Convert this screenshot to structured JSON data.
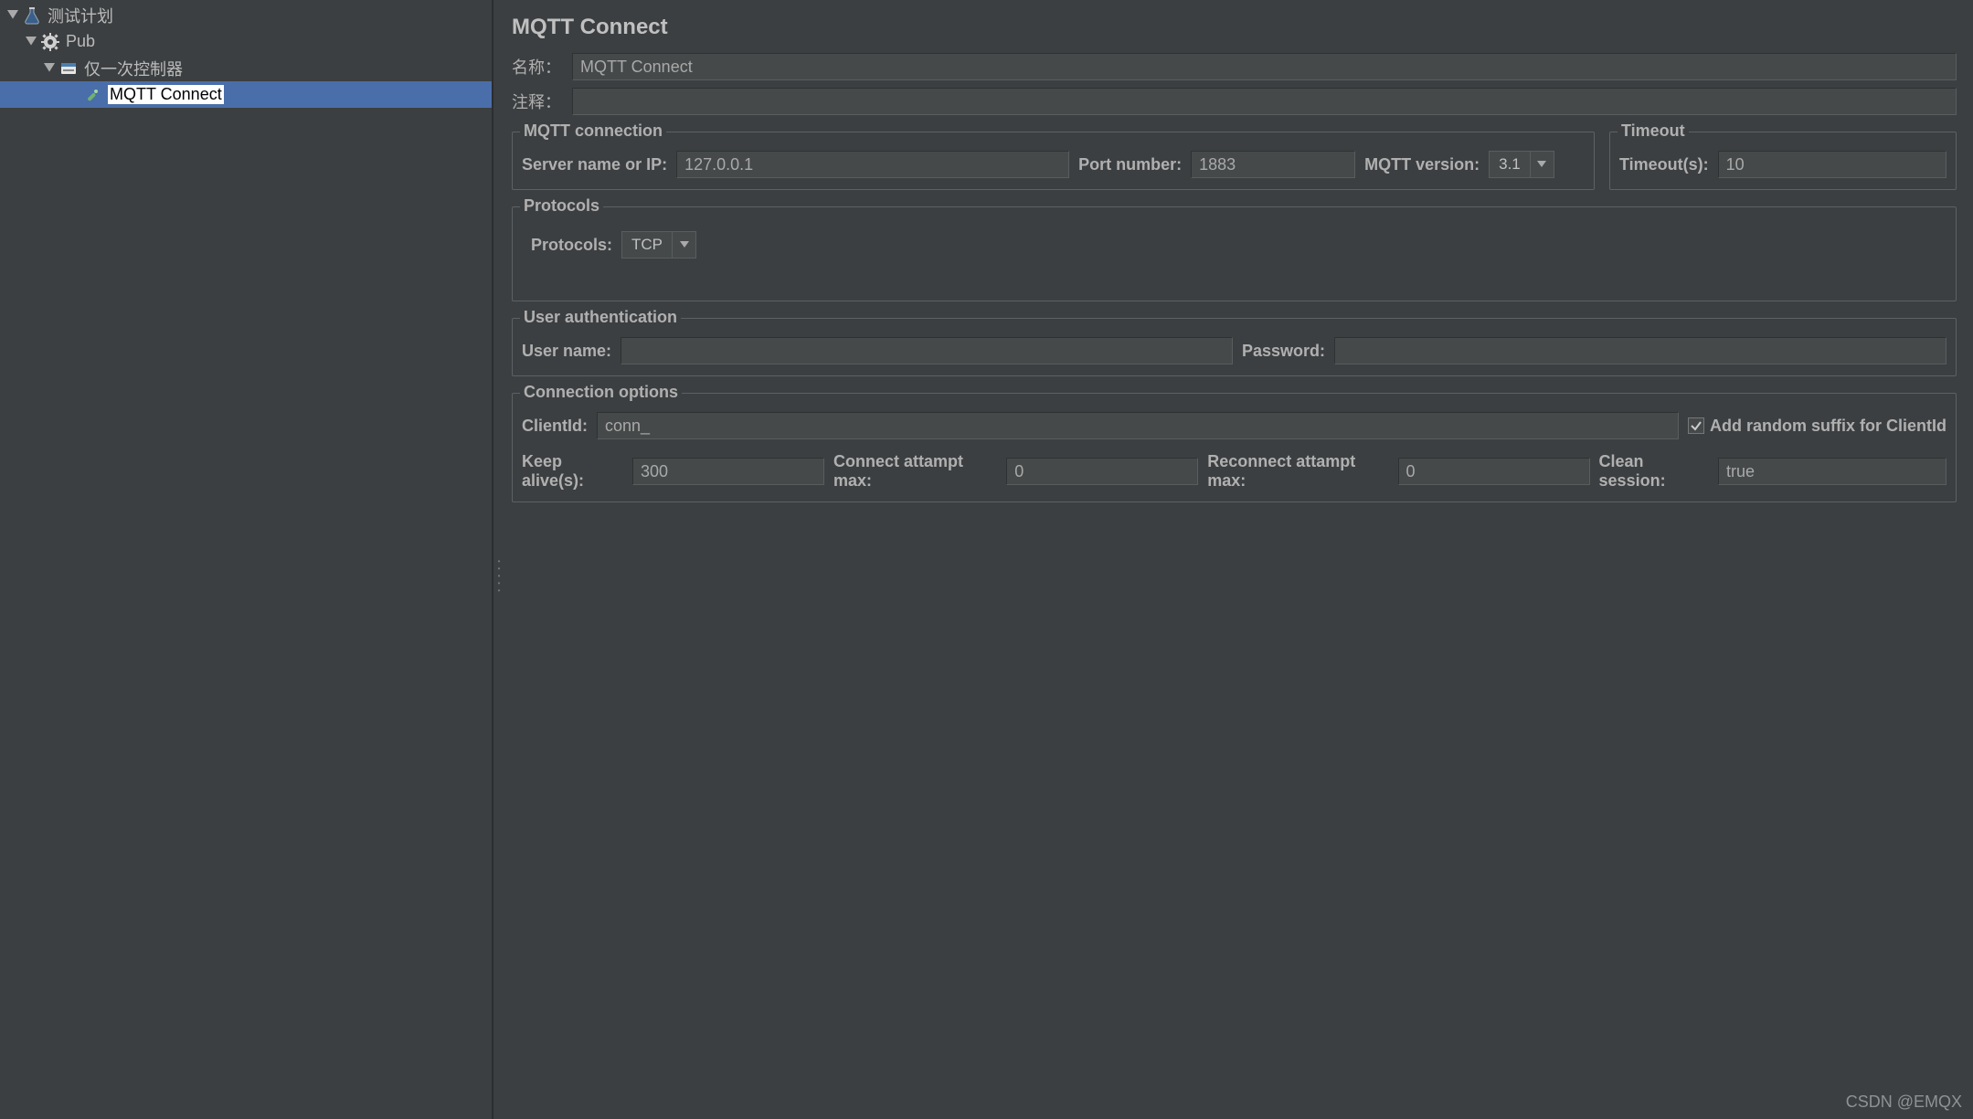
{
  "tree": {
    "items": [
      {
        "label": "测试计划",
        "indent": 0,
        "icon": "flask",
        "expanded": true,
        "selected": false
      },
      {
        "label": "Pub",
        "indent": 1,
        "icon": "gear",
        "expanded": true,
        "selected": false
      },
      {
        "label": "仅一次控制器",
        "indent": 2,
        "icon": "controller",
        "expanded": true,
        "selected": false
      },
      {
        "label": "MQTT Connect",
        "indent": 3,
        "icon": "sampler",
        "expanded": false,
        "selected": true,
        "highlighted": true
      }
    ]
  },
  "page": {
    "title": "MQTT Connect",
    "name_label": "名称：",
    "name_value": "MQTT Connect",
    "comment_label": "注释：",
    "comment_value": ""
  },
  "mqtt_connection": {
    "legend": "MQTT connection",
    "server_label": "Server name or IP:",
    "server_value": "127.0.0.1",
    "port_label": "Port number:",
    "port_value": "1883",
    "version_label": "MQTT version:",
    "version_value": "3.1"
  },
  "timeout": {
    "legend": "Timeout",
    "label": "Timeout(s):",
    "value": "10"
  },
  "protocols": {
    "legend": "Protocols",
    "label": "Protocols:",
    "value": "TCP"
  },
  "user_auth": {
    "legend": "User authentication",
    "username_label": "User name:",
    "username_value": "",
    "password_label": "Password:",
    "password_value": ""
  },
  "conn_options": {
    "legend": "Connection options",
    "clientid_label": "ClientId:",
    "clientid_value": "conn_",
    "random_suffix_label": "Add random suffix for ClientId",
    "random_suffix_checked": true,
    "keepalive_label": "Keep alive(s):",
    "keepalive_value": "300",
    "connect_attempt_label": "Connect attampt max:",
    "connect_attempt_value": "0",
    "reconnect_attempt_label": "Reconnect attampt max:",
    "reconnect_attempt_value": "0",
    "clean_session_label": "Clean session:",
    "clean_session_value": "true"
  },
  "watermark": "CSDN @EMQX"
}
